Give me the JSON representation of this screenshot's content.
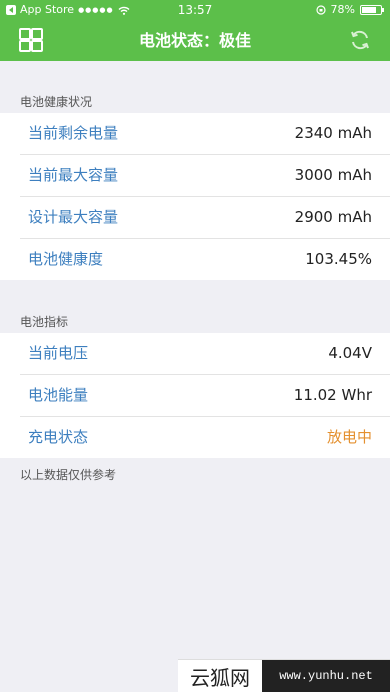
{
  "status_bar": {
    "carrier": "App Store",
    "signal": "●●●●●",
    "time": "13:57",
    "battery_percent": "78%",
    "battery_level": 0.78
  },
  "nav": {
    "title": "电池状态：极佳",
    "left_icon": "grid-icon",
    "right_icon": "refresh-icon"
  },
  "battery_health": {
    "header": "电池健康状况",
    "rows": [
      {
        "label": "当前剩余电量",
        "value": "2340 mAh"
      },
      {
        "label": "当前最大容量",
        "value": "3000 mAh"
      },
      {
        "label": "设计最大容量",
        "value": "2900 mAh"
      },
      {
        "label": "电池健康度",
        "value": "103.45%"
      }
    ]
  },
  "battery_metrics": {
    "header": "电池指标",
    "rows": [
      {
        "label": "当前电压",
        "value": "4.04V"
      },
      {
        "label": "电池能量",
        "value": "11.02 Whr"
      },
      {
        "label": "充电状态",
        "value": "放电中"
      }
    ]
  },
  "footnote": "以上数据仅供参考",
  "watermark": {
    "logo": "云狐网",
    "url": "www.yunhu.net"
  },
  "colors": {
    "nav_green": "#5cbf4a",
    "label_blue": "#3d7fbf",
    "status_orange": "#e4902f"
  }
}
